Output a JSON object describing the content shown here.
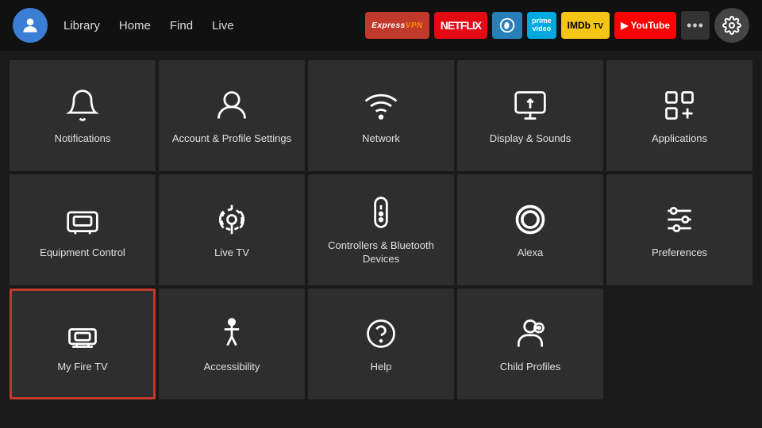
{
  "nav": {
    "links": [
      "Library",
      "Home",
      "Find",
      "Live"
    ],
    "apps": [
      {
        "label": "ExpressVPN",
        "class": "expressvpn"
      },
      {
        "label": "NETFLIX",
        "class": "netflix"
      },
      {
        "label": "Discovery+",
        "class": "discovery"
      },
      {
        "label": "prime video",
        "class": "primevideo"
      },
      {
        "label": "IMDb TV",
        "class": "imdb"
      },
      {
        "label": "▶ YouTube",
        "class": "youtube"
      }
    ],
    "more_label": "•••",
    "settings_icon": "gear"
  },
  "grid": {
    "items": [
      {
        "id": "notifications",
        "label": "Notifications",
        "icon": "bell",
        "selected": false
      },
      {
        "id": "account",
        "label": "Account & Profile Settings",
        "icon": "person",
        "selected": false
      },
      {
        "id": "network",
        "label": "Network",
        "icon": "wifi",
        "selected": false
      },
      {
        "id": "display",
        "label": "Display & Sounds",
        "icon": "display",
        "selected": false
      },
      {
        "id": "applications",
        "label": "Applications",
        "icon": "apps",
        "selected": false
      },
      {
        "id": "equipment",
        "label": "Equipment Control",
        "icon": "tv",
        "selected": false
      },
      {
        "id": "livetv",
        "label": "Live TV",
        "icon": "antenna",
        "selected": false
      },
      {
        "id": "controllers",
        "label": "Controllers & Bluetooth Devices",
        "icon": "remote",
        "selected": false
      },
      {
        "id": "alexa",
        "label": "Alexa",
        "icon": "alexa",
        "selected": false
      },
      {
        "id": "preferences",
        "label": "Preferences",
        "icon": "sliders",
        "selected": false
      },
      {
        "id": "myfiretv",
        "label": "My Fire TV",
        "icon": "firetv",
        "selected": true
      },
      {
        "id": "accessibility",
        "label": "Accessibility",
        "icon": "accessibility",
        "selected": false
      },
      {
        "id": "help",
        "label": "Help",
        "icon": "help",
        "selected": false
      },
      {
        "id": "childprofiles",
        "label": "Child Profiles",
        "icon": "childprofiles",
        "selected": false
      }
    ]
  }
}
